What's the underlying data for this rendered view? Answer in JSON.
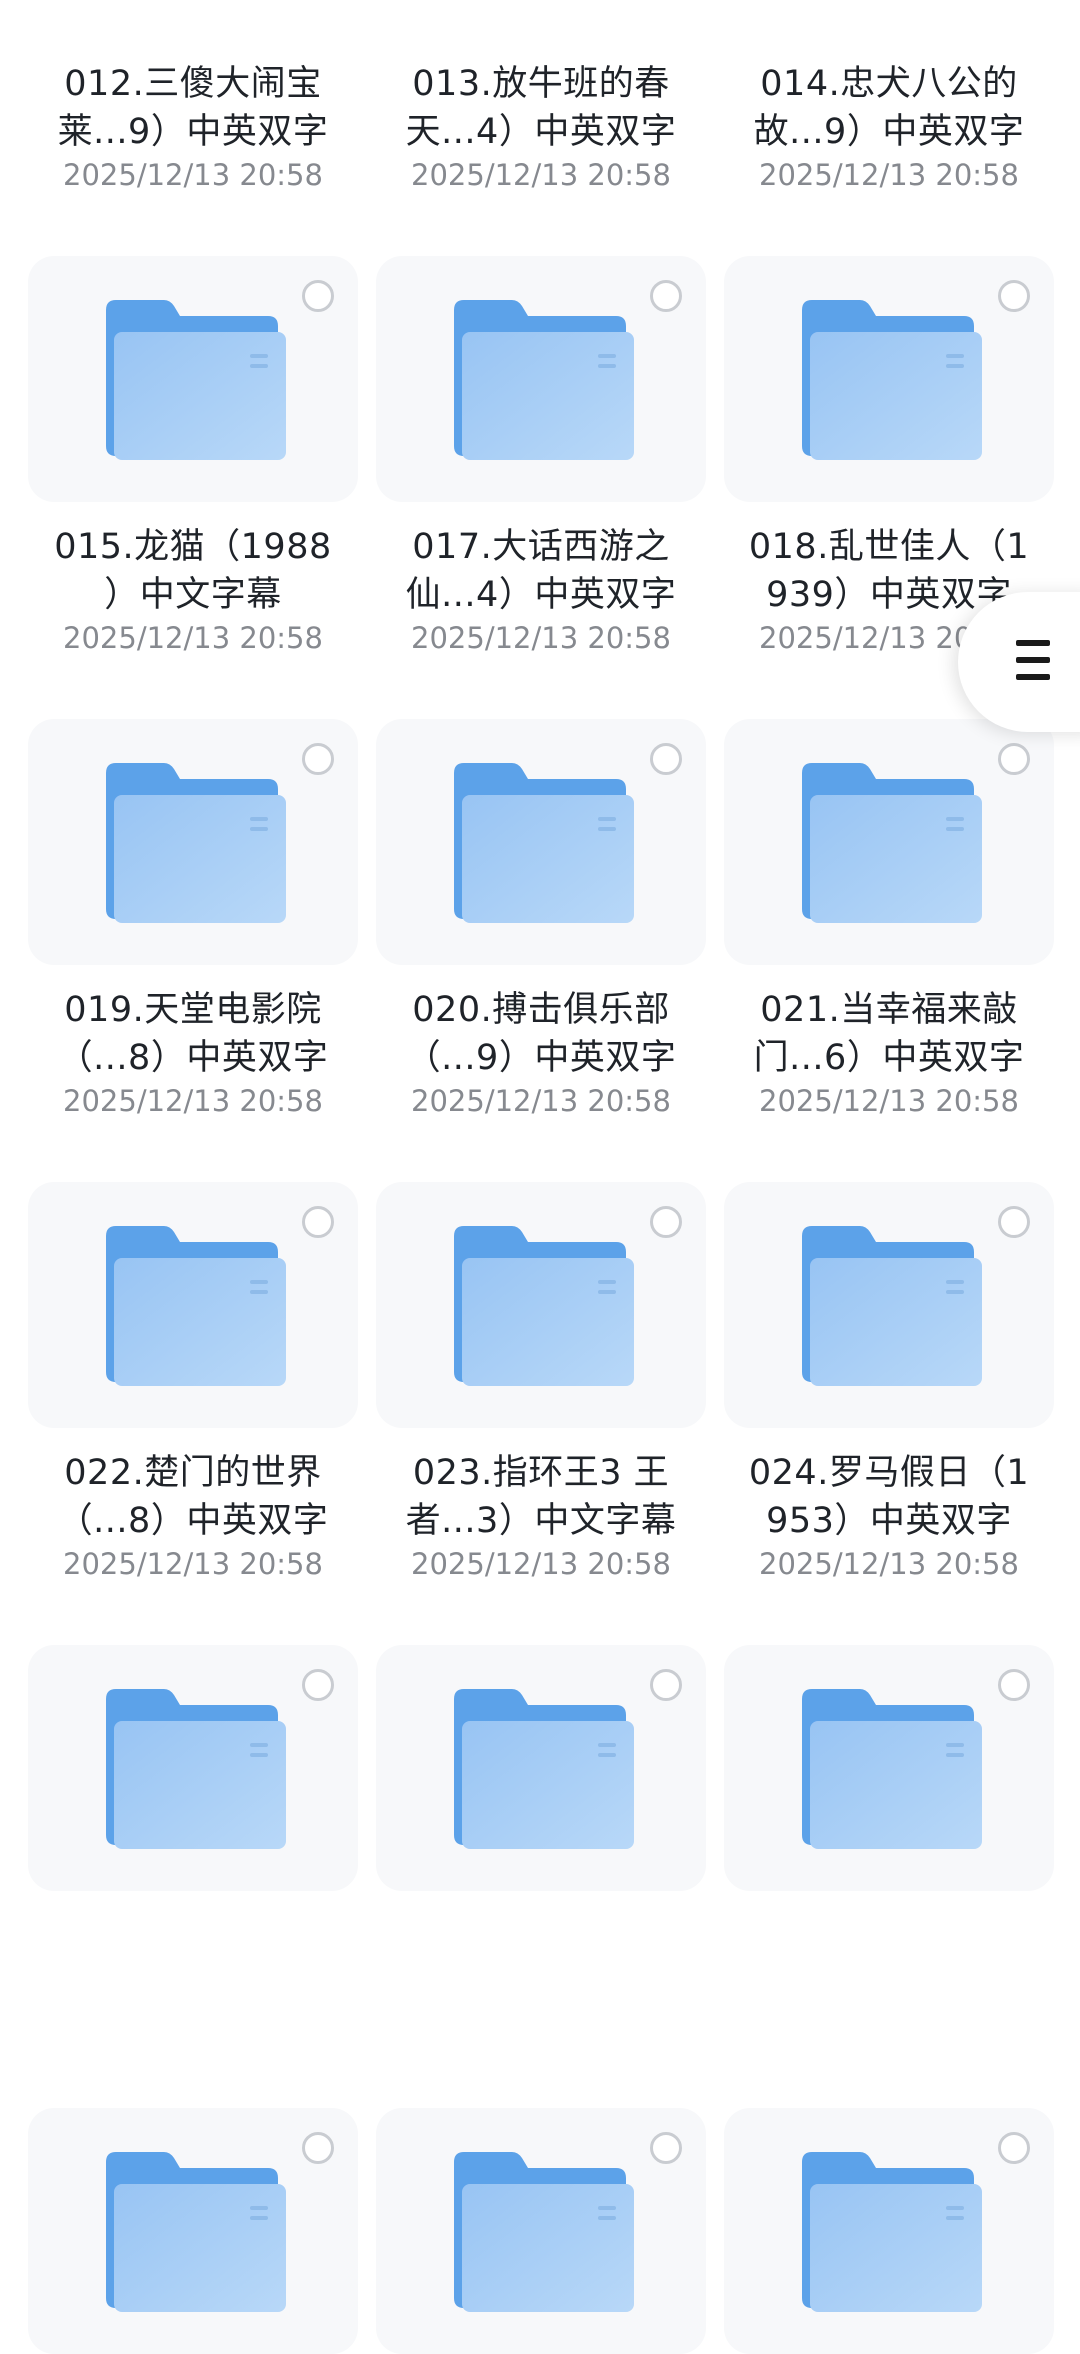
{
  "colors": {
    "background": "#ffffff",
    "tile_background": "#f7f8fa",
    "folder_back": "#5ca2e9",
    "folder_front": "#a9cff5",
    "title_text": "#1f2329",
    "date_text": "#86898f",
    "radio_border": "#c9ccd1"
  },
  "icons": {
    "folder": "folder-icon",
    "selection": "radio-unchecked-icon",
    "menu": "hamburger-menu-icon"
  },
  "files": [
    {
      "name": "012.三傻大闹宝\n莱...9）中英双字",
      "date": "2025/12/13 20:58"
    },
    {
      "name": "013.放牛班的春\n天...4）中英双字",
      "date": "2025/12/13 20:58"
    },
    {
      "name": "014.忠犬八公的\n故...9）中英双字",
      "date": "2025/12/13 20:58"
    },
    {
      "name": "015.龙猫（1988\n）中文字幕",
      "date": "2025/12/13 20:58"
    },
    {
      "name": "017.大话西游之\n仙...4）中英双字",
      "date": "2025/12/13 20:58"
    },
    {
      "name": "018.乱世佳人（1\n939）中英双字",
      "date": "2025/12/13 20:58"
    },
    {
      "name": "019.天堂电影院\n（...8）中英双字",
      "date": "2025/12/13 20:58"
    },
    {
      "name": "020.搏击俱乐部\n（...9）中英双字",
      "date": "2025/12/13 20:58"
    },
    {
      "name": "021.当幸福来敲\n门...6）中英双字",
      "date": "2025/12/13 20:58"
    },
    {
      "name": "022.楚门的世界\n（...8）中英双字",
      "date": "2025/12/13 20:58"
    },
    {
      "name": "023.指环王3 王\n者...3）中文字幕",
      "date": "2025/12/13 20:58"
    },
    {
      "name": "024.罗马假日（1\n953）中英双字",
      "date": "2025/12/13 20:58"
    }
  ]
}
